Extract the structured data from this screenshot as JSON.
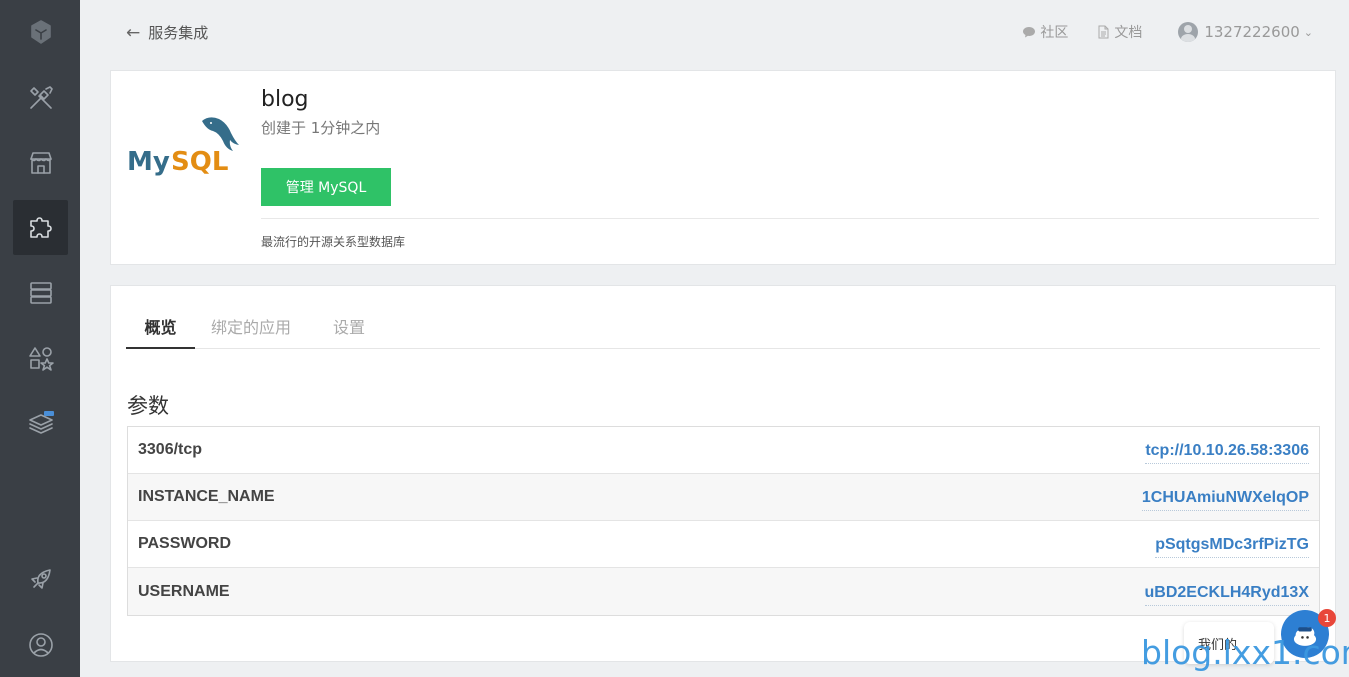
{
  "sidebar": {
    "items": [
      {
        "name": "logo-icon"
      },
      {
        "name": "tools-icon"
      },
      {
        "name": "store-icon"
      },
      {
        "name": "puzzle-icon",
        "active": true
      },
      {
        "name": "server-icon"
      },
      {
        "name": "shapes-icon"
      },
      {
        "name": "layers-beta-icon",
        "badge": "Beta"
      },
      {
        "name": "rocket-icon"
      },
      {
        "name": "user-circle-icon"
      }
    ]
  },
  "topbar": {
    "back_label": "服务集成",
    "community_label": "社区",
    "docs_label": "文档",
    "username": "1327222600"
  },
  "service": {
    "logo_text": "MySQL",
    "name": "blog",
    "created": "创建于 1分钟之内",
    "manage_button": "管理 MySQL",
    "description": "最流行的开源关系型数据库"
  },
  "tabs": [
    {
      "label": "概览",
      "active": true
    },
    {
      "label": "绑定的应用"
    },
    {
      "label": "设置"
    }
  ],
  "params": {
    "title": "参数",
    "rows": [
      {
        "key": "3306/tcp",
        "value": "tcp://10.10.26.58:3306"
      },
      {
        "key": "INSTANCE_NAME",
        "value": "1CHUAmiuNWXelqOP"
      },
      {
        "key": "PASSWORD",
        "value": "pSqtgsMDc3rfPizTG"
      },
      {
        "key": "USERNAME",
        "value": "uBD2ECKLH4Ryd13X"
      }
    ]
  },
  "chat": {
    "bubble_text": "我们的",
    "badge_count": "1"
  },
  "watermark": "blog.lxx1.com",
  "colors": {
    "sidebar": "#3a3f45",
    "accent_green": "#2fc267",
    "link_blue": "#3a7fc4"
  }
}
